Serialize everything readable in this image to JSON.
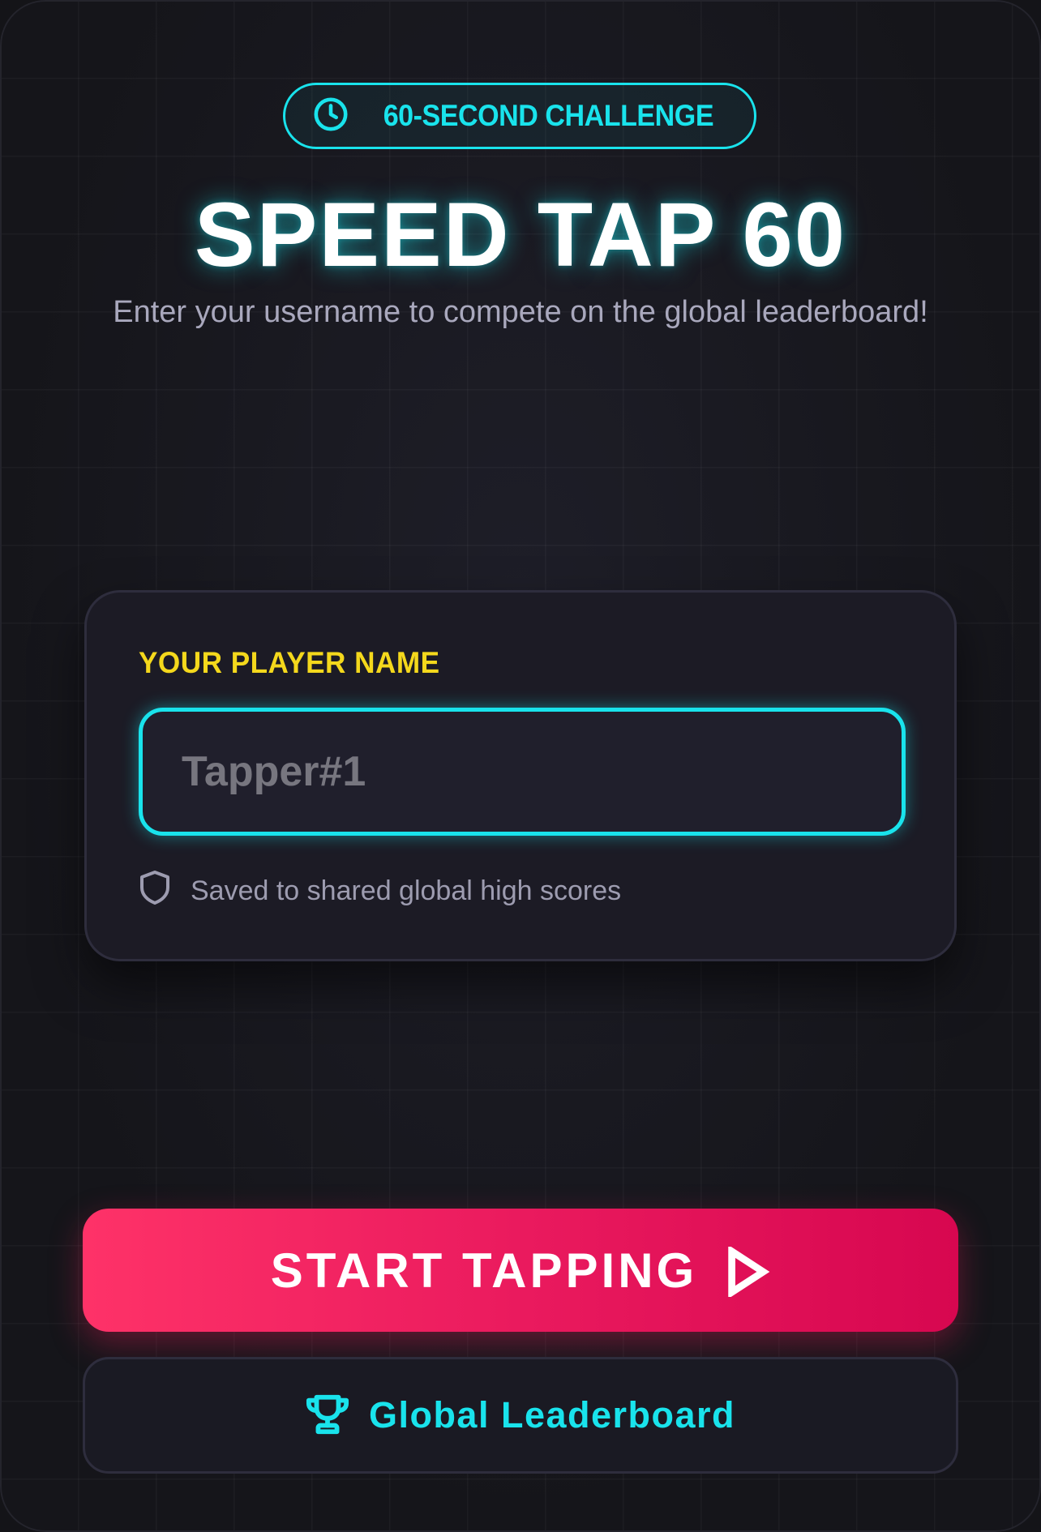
{
  "badge": {
    "icon": "clock-icon",
    "label": "60-SECOND CHALLENGE"
  },
  "title": "SPEED TAP 60",
  "subtitle": "Enter your username to compete on the global leaderboard!",
  "form": {
    "label": "YOUR PLAYER NAME",
    "input_value": "",
    "input_placeholder": "Tapper#1",
    "note_icon": "shield-icon",
    "note": "Saved to shared global high scores"
  },
  "actions": {
    "start_label": "START TAPPING",
    "start_icon": "play-icon",
    "leaderboard_label": "Global Leaderboard",
    "leaderboard_icon": "trophy-icon"
  },
  "colors": {
    "accent_cyan": "#19e3ec",
    "accent_yellow": "#f4d81c",
    "primary_pink": "#ea1a5e",
    "background": "#16161c"
  }
}
